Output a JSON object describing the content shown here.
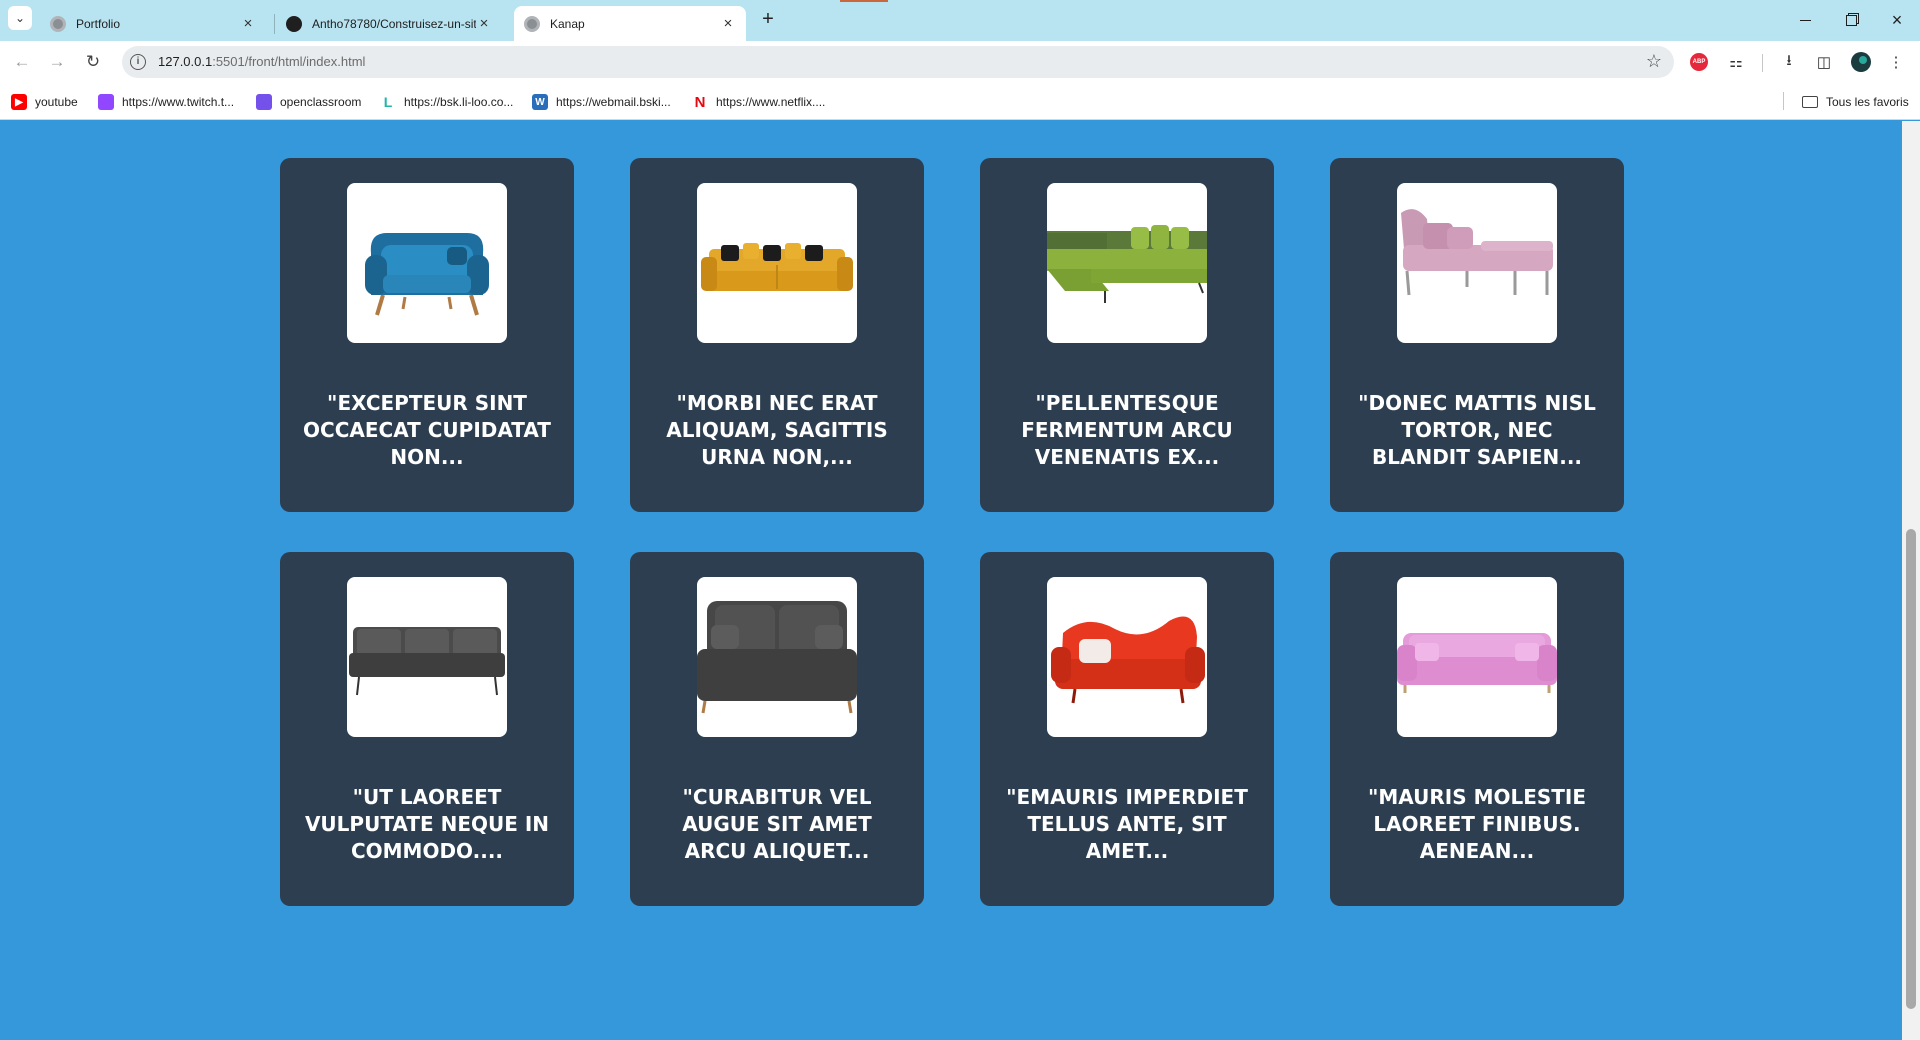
{
  "browser": {
    "tabs": [
      {
        "title": "Portfolio",
        "icon": "globe-icon",
        "active": false
      },
      {
        "title": "Antho78780/Construisez-un-sit",
        "icon": "github-icon",
        "active": false
      },
      {
        "title": "Kanap",
        "icon": "globe-icon",
        "active": true
      }
    ],
    "url_host": "127.0.0.1",
    "url_rest": ":5501/front/html/index.html",
    "bookmarks": [
      {
        "label": "youtube",
        "icon": "youtube-icon",
        "color": "#ff0000"
      },
      {
        "label": "https://www.twitch.t...",
        "icon": "twitch-icon",
        "color": "#9146ff"
      },
      {
        "label": "openclassroom",
        "icon": "openclassrooms-icon",
        "color": "#7451eb"
      },
      {
        "label": "https://bsk.li-loo.co...",
        "icon": "liloo-icon",
        "color": "#21b5a8"
      },
      {
        "label": "https://webmail.bski...",
        "icon": "webmail-icon",
        "color": "#2a6ebb"
      },
      {
        "label": "https://www.netflix....",
        "icon": "netflix-icon",
        "color": "#e50914"
      }
    ],
    "all_bookmarks_label": "Tous les favoris",
    "abp_label": "ABP"
  },
  "products": [
    {
      "name": "\"Excepteur sint occaecat cupidatat non...",
      "image": "sofa-blue"
    },
    {
      "name": "\"Morbi nec erat aliquam, sagittis urna non,...",
      "image": "sofa-yellow"
    },
    {
      "name": "\"Pellentesque fermentum arcu venenatis ex...",
      "image": "sofa-green-corner"
    },
    {
      "name": "\"Donec mattis nisl tortor, nec blandit sapien...",
      "image": "sofa-pink-chaise"
    },
    {
      "name": "\"Ut laoreet vulputate neque in commodo....",
      "image": "sofa-grey"
    },
    {
      "name": "\"Curabitur vel augue sit amet arcu aliquet...",
      "image": "sofa-dark-grey"
    },
    {
      "name": "\"Emauris imperdiet tellus ante, sit amet...",
      "image": "sofa-red"
    },
    {
      "name": "\"Mauris molestie laoreet finibus. Aenean...",
      "image": "sofa-pink"
    }
  ],
  "colors": {
    "page_background": "#3498db",
    "card_background": "#2c3e50",
    "card_text": "#ffffff",
    "tabstrip": "#b8e3f0"
  }
}
